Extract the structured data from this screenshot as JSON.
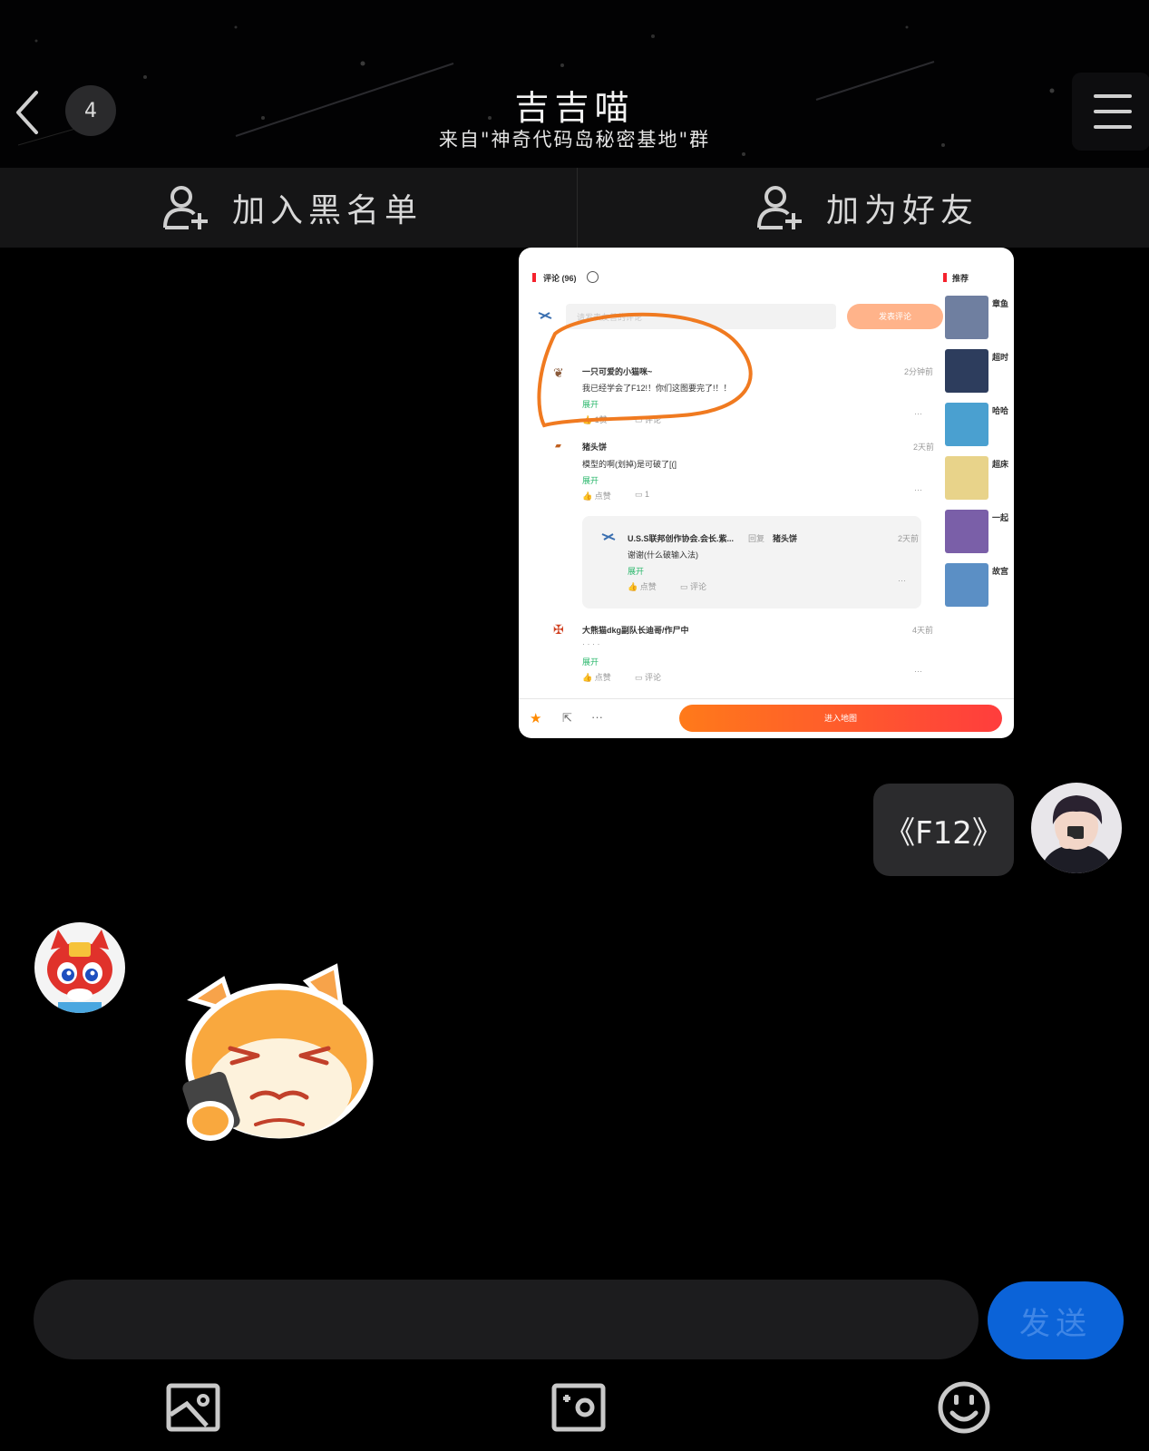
{
  "header": {
    "badge_count": "4",
    "title": "吉吉喵",
    "subtitle": "来自\"神奇代码岛秘密基地\"群"
  },
  "actions": {
    "blacklist_label": "加入黑名单",
    "add_friend_label": "加为好友"
  },
  "shared_image": {
    "comments_header": "评论 (96)",
    "recommend_header": "推荐",
    "comment_placeholder": "请发表友善的评论",
    "post_button": "发表评论",
    "comments": [
      {
        "user": "一只可爱的小猫咪~",
        "time": "2分钟前",
        "text": "我已经学会了F12!！你们这图要完了!！！",
        "expand": "展开",
        "likes": "1赞",
        "replies": "评论"
      },
      {
        "user": "猪头饼",
        "time": "2天前",
        "text": "模型的啊(划掉)是可破了[(]",
        "expand": "展开",
        "likes": "点赞",
        "replies": "1"
      },
      {
        "user": "U.S.S联邦创作协会.会长.紫...",
        "reply_word": "回复",
        "reply_to": "猪头饼",
        "time": "2天前",
        "text": "谢谢(什么破输入法)",
        "expand": "展开",
        "likes": "点赞",
        "replies": "评论"
      },
      {
        "user": "大熊猫dkg副队长迪哥/作尸中",
        "time": "4天前",
        "text": "· · · ·",
        "expand": "展开",
        "likes": "点赞",
        "replies": "评论"
      }
    ],
    "recommend_items": [
      "章鱼",
      "超时",
      "哈哈",
      "超床",
      "一起",
      "故宫"
    ],
    "enter_button": "进入地图"
  },
  "messages": {
    "my_text": "《F12》"
  },
  "composer": {
    "input_value": "",
    "input_placeholder": "",
    "send_label": "发送"
  },
  "toolbar": {
    "icons": [
      "image-icon",
      "camera-icon",
      "emoji-icon"
    ]
  },
  "colors": {
    "accent_blue": "#0b63d8",
    "orange_circle": "#f07a20",
    "cta_orange": "#ff6a1a"
  }
}
